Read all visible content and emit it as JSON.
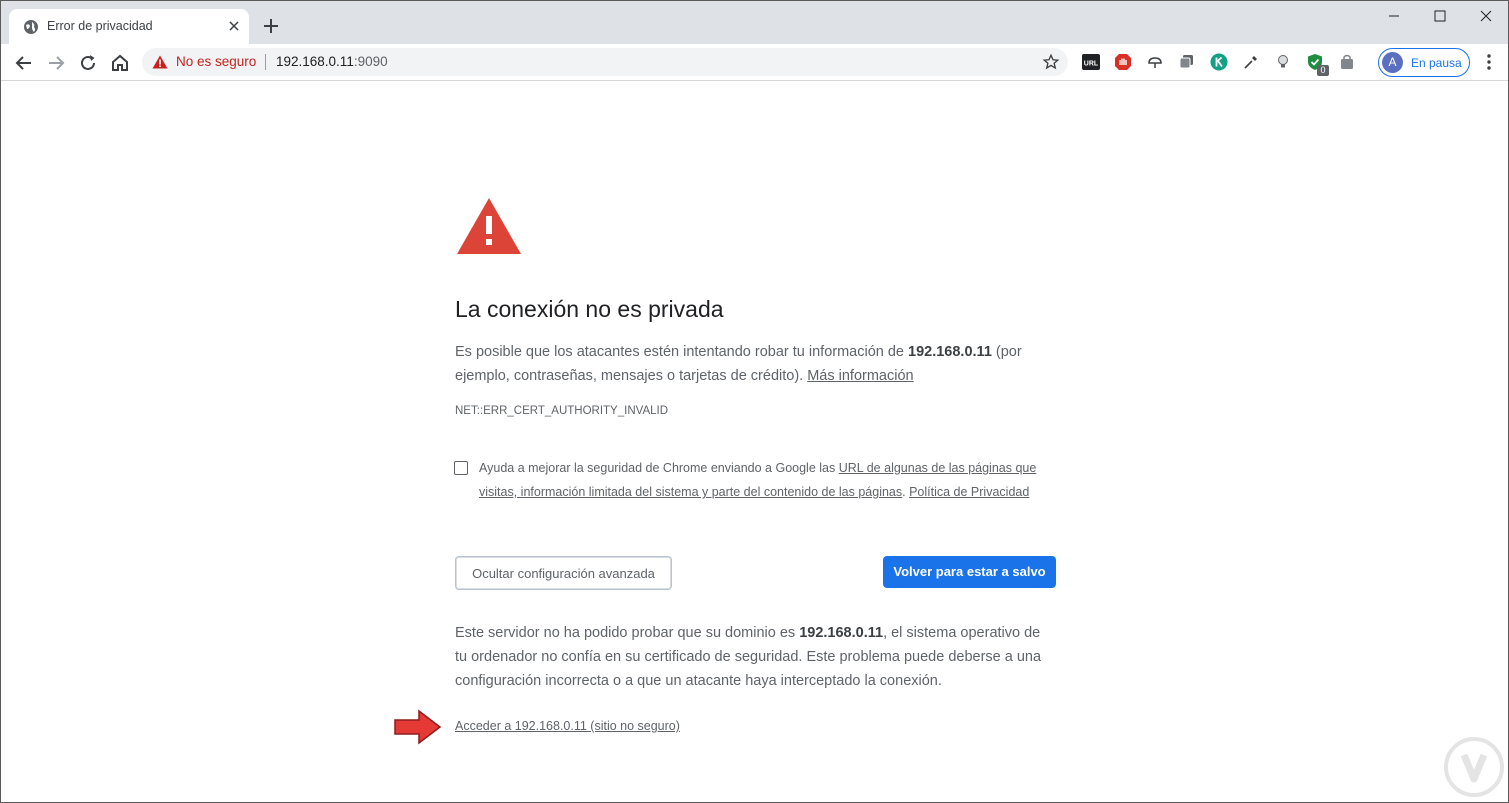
{
  "browser": {
    "tab": {
      "title": "Error de privacidad"
    },
    "omnibox": {
      "security_label": "No es seguro",
      "host": "192.168.0.11",
      "port": ":9090"
    },
    "profile": {
      "initial": "A",
      "label": "En pausa"
    },
    "extensions": [
      "url-extension-icon",
      "adblock-icon",
      "weather-icon",
      "copy-extension-icon",
      "kaspersky-icon",
      "eyedropper-icon",
      "lightbulb-icon",
      "shield-check-icon",
      "bag-icon"
    ],
    "extension_badge": "0",
    "extension_url_text": "URL"
  },
  "interstitial": {
    "heading": "La conexión no es privada",
    "intro_prefix": "Es posible que los atacantes estén intentando robar tu información de ",
    "intro_domain": "192.168.0.11",
    "intro_suffix": " (por ejemplo, contraseñas, mensajes o tarjetas de crédito). ",
    "learn_more": "Más información",
    "error_code": "NET::ERR_CERT_AUTHORITY_INVALID",
    "checkbox_prefix": "Ayuda a mejorar la seguridad de Chrome enviando a Google las ",
    "checkbox_link": "URL de algunas de las páginas que visitas, información limitada del sistema y parte del contenido de las páginas",
    "checkbox_sep": ". ",
    "privacy_link": "Política de Privacidad",
    "hide_advanced": "Ocultar configuración avanzada",
    "back_to_safety": "Volver para estar a salvo",
    "details_prefix": "Este servidor no ha podido probar que su dominio es ",
    "details_domain": "192.168.0.11",
    "details_suffix": ", el sistema operativo de tu ordenador no confía en su certificado de seguridad. Este problema puede deberse a una configuración incorrecta o a que un atacante haya interceptado la conexión.",
    "proceed_link": "Acceder a 192.168.0.11 (sitio no seguro)"
  },
  "colors": {
    "accent": "#1a73e8",
    "danger": "#db4437",
    "arrow": "#e53935"
  }
}
